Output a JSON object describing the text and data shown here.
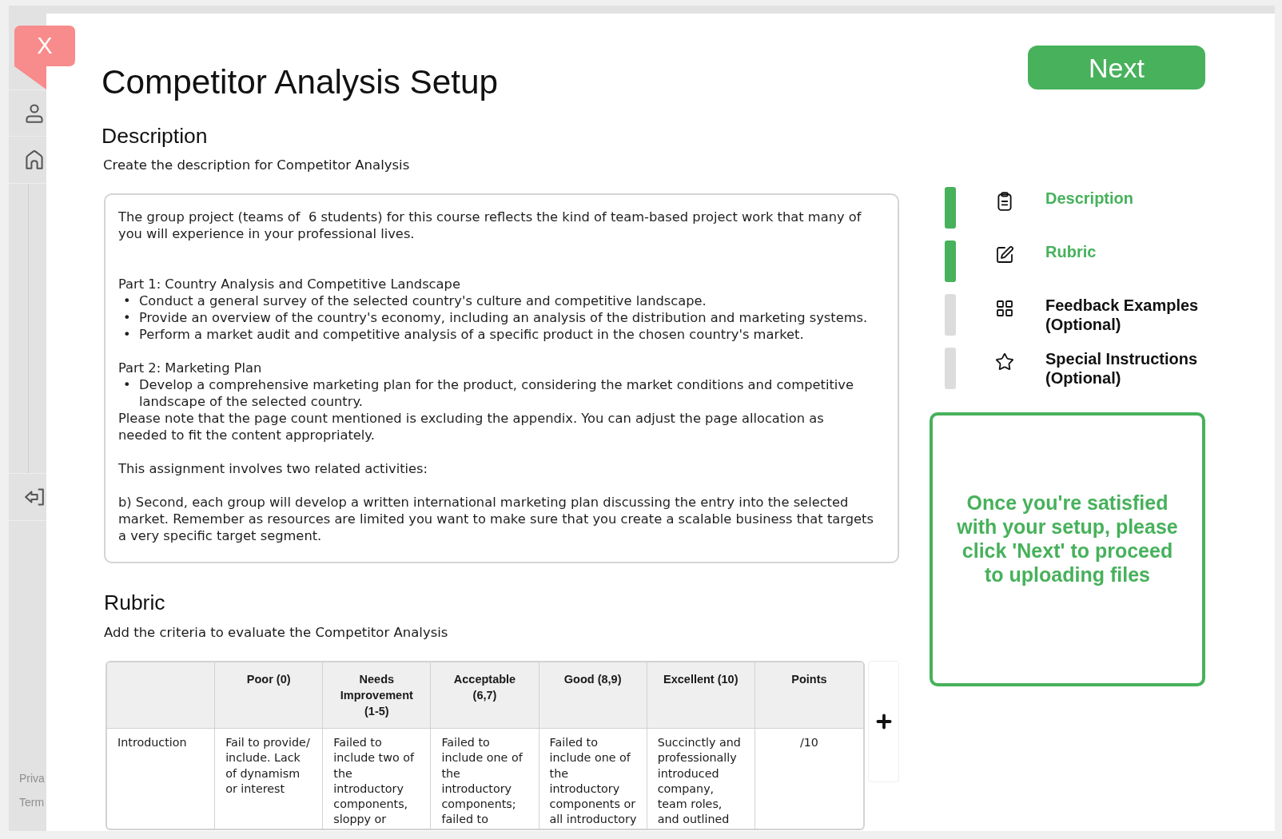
{
  "close_button": {
    "label": "X"
  },
  "sidebar": {
    "footer_links": [
      "Priva",
      "Term"
    ]
  },
  "title": "Competitor Analysis Setup",
  "description": {
    "heading": "Description",
    "hint": "Create the description for Competitor Analysis",
    "editor": {
      "blocks": [
        {
          "kind": "paragraph",
          "text": "The group project (teams of  6 students) for this course reflects the kind of team-based project work that many of\nyou will experience in your professional lives."
        },
        {
          "kind": "empty"
        },
        {
          "kind": "empty"
        },
        {
          "kind": "paragraph",
          "text": "Part 1: Country Analysis and Competitive Landscape"
        },
        {
          "kind": "bullet",
          "marker": "•",
          "text": "Conduct a general survey of the selected country's culture and competitive landscape."
        },
        {
          "kind": "bullet",
          "marker": "•",
          "text": "Provide an overview of the country's economy, including an analysis of the distribution and marketing systems."
        },
        {
          "kind": "bullet",
          "marker": "•",
          "text": "Perform a market audit and competitive analysis of a specific product in the chosen country's market."
        },
        {
          "kind": "empty"
        },
        {
          "kind": "paragraph",
          "text": "Part 2: Marketing Plan"
        },
        {
          "kind": "bullet",
          "marker": "•",
          "text": "Develop a comprehensive marketing plan for the product, considering the market conditions and competitive\nlandscape of the selected country."
        },
        {
          "kind": "paragraph",
          "text": "Please note that the page count mentioned is excluding the appendix. You can adjust the page allocation as\nneeded to fit the content appropriately."
        },
        {
          "kind": "empty"
        },
        {
          "kind": "paragraph",
          "text": "This assignment involves two related activities:"
        },
        {
          "kind": "empty"
        },
        {
          "kind": "paragraph",
          "text": "b) Second, each group will develop a written international marketing plan discussing the entry into the selected\nmarket. Remember as resources are limited you want to make sure that you create a scalable business that targets\na very specific target segment."
        }
      ]
    }
  },
  "rubric": {
    "heading": "Rubric",
    "hint": "Add the criteria to evaluate the Competitor Analysis",
    "table": {
      "columns": [
        "Poor (0)",
        "Needs\nImprovement\n(1-5)",
        "Acceptable\n(6,7)",
        "Good (8,9)",
        "Excellent (10)",
        "Points"
      ],
      "rows": [
        {
          "criterion": "Introduction",
          "cells": [
            "Fail to provide/\ninclude. Lack\nof dynamism\nor interest",
            "Failed to\ninclude two of\nthe\nintroductory\ncomponents,\nsloppy or",
            "Failed to\ninclude one of\nthe\nintroductory\ncomponents;\nfailed to",
            "Failed to\ninclude one of\nthe\nintroductory\ncomponents or\nall introductory",
            "Succinctly and\nprofessionally\nintroduced\ncompany,\nteam roles,\nand outlined",
            "/10"
          ]
        }
      ]
    }
  },
  "next_button": {
    "label": "Next"
  },
  "steps": [
    {
      "label": "Description",
      "done": true
    },
    {
      "label": "Rubric",
      "done": true
    },
    {
      "label": "Feedback Examples (Optional)",
      "done": false
    },
    {
      "label": "Special Instructions (Optional)",
      "done": false
    }
  ],
  "notice": {
    "text": "Once you're satisfied with your setup, please click 'Next' to proceed to uploading files"
  }
}
